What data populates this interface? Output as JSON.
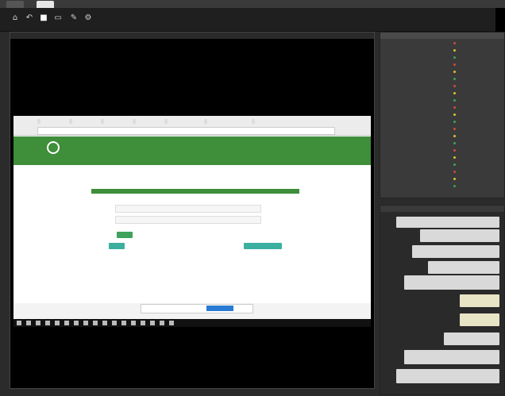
{
  "window": {
    "title": "",
    "status_right": ""
  },
  "toolbar": {
    "buttons": [
      {
        "name": "home-icon",
        "glyph": "⌂"
      },
      {
        "name": "back-icon",
        "glyph": "↶"
      },
      {
        "name": "stop-icon",
        "glyph": "■"
      },
      {
        "name": "resize-icon",
        "glyph": "▭"
      },
      {
        "name": "pen-icon",
        "glyph": "✎"
      },
      {
        "name": "settings-icon",
        "glyph": "⚙"
      }
    ]
  },
  "remote_screen": {
    "url": "",
    "bookmarks": [
      "",
      "",
      "",
      "",
      "",
      "",
      ""
    ],
    "site_title": "",
    "site_brand": "",
    "nav": [
      "",
      "",
      "",
      "",
      "",
      ""
    ],
    "form": {
      "field1_label": "",
      "field2_label": "",
      "remember_label": "",
      "login_button": "",
      "register_button": "",
      "forgot_button": ""
    },
    "toast": {
      "text": "",
      "button": ""
    }
  },
  "participants": {
    "items": [
      "",
      "",
      "",
      "",
      "",
      "",
      "",
      "",
      "",
      "",
      "",
      "",
      "",
      "",
      "",
      "",
      "",
      "",
      "",
      "",
      ""
    ]
  },
  "chat": {
    "messages": [
      {
        "name": "",
        "text": ""
      },
      {
        "name": "",
        "text": ""
      },
      {
        "name": "",
        "text": ""
      },
      {
        "name": "",
        "text": ""
      },
      {
        "name": "",
        "text": ""
      },
      {
        "name": "",
        "text": ""
      },
      {
        "name": "",
        "text": ""
      },
      {
        "name": "",
        "text": ""
      },
      {
        "name": "",
        "text": ""
      },
      {
        "name": "",
        "text": ""
      }
    ]
  },
  "colors": {
    "site_green": "#3e8e3a",
    "button_green": "#3ea15c",
    "button_teal": "#3bb0a0",
    "toast_blue": "#2a7bd4",
    "status_dot_yellow": "#d9c22e",
    "status_dot_green": "#3ea15c",
    "status_dot_red": "#d24a3a"
  }
}
